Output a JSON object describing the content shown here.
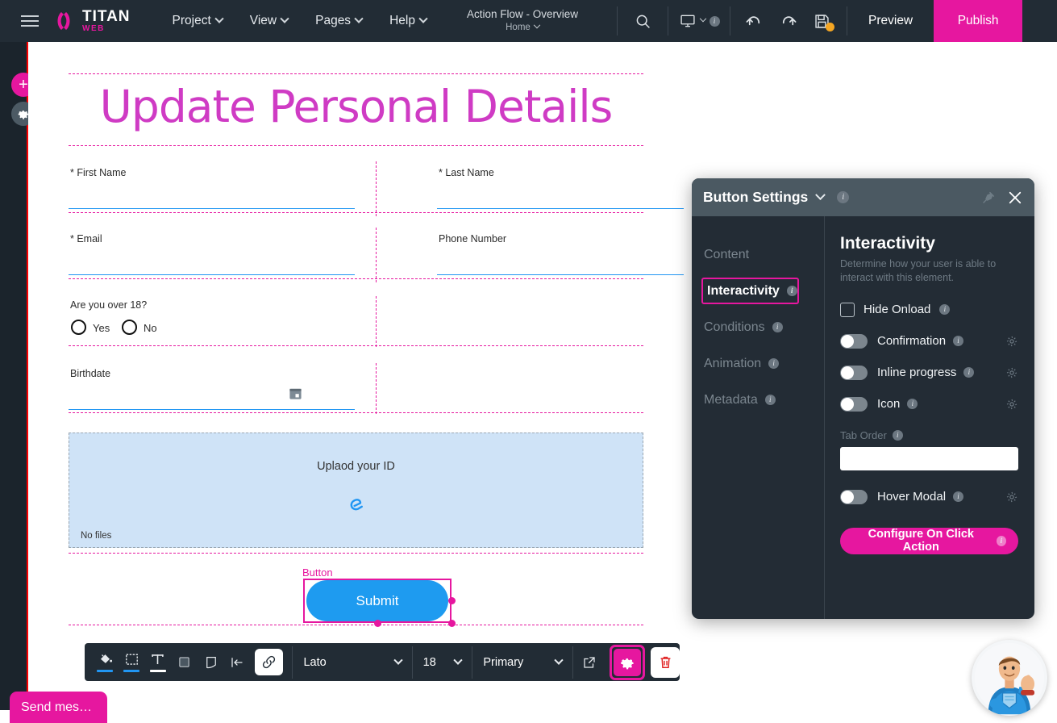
{
  "app": {
    "brand_name": "TITAN",
    "brand_sub": "WEB",
    "accent_pink": "#e6179f",
    "accent_blue": "#1e9bf0",
    "panel_bg": "#232c35",
    "topbar_bg": "#222c35"
  },
  "topbar": {
    "menu": [
      {
        "label": "Project"
      },
      {
        "label": "View"
      },
      {
        "label": "Pages"
      },
      {
        "label": "Help"
      }
    ],
    "flow_title": "Action Flow - Overview",
    "flow_page": "Home",
    "search_icon": "search-icon",
    "device_icon": "desktop-icon",
    "undo_icon": "undo-icon",
    "redo_icon": "redo-icon",
    "save_icon": "save-icon",
    "preview_label": "Preview",
    "publish_label": "Publish"
  },
  "leftrail": {
    "add_label": "+",
    "gear_label": "gear-icon"
  },
  "canvas": {
    "page_title": "Update Personal Details",
    "fields": [
      {
        "label": "* First Name"
      },
      {
        "label": "* Last Name"
      },
      {
        "label": "* Email"
      },
      {
        "label": "Phone Number"
      }
    ],
    "radio_question": "Are you over 18?",
    "radio_options": [
      "Yes",
      "No"
    ],
    "birthdate_label": "Birthdate",
    "upload": {
      "text": "Uplaod your ID",
      "icon": "paperclip-icon",
      "no_files": "No files"
    },
    "button_tag": "Button",
    "submit_label": "Submit"
  },
  "panel": {
    "title": "Button Settings",
    "pin_icon": "pin-icon",
    "close_icon": "close-icon",
    "nav": [
      {
        "label": "Content",
        "info": false,
        "active": false
      },
      {
        "label": "Interactivity",
        "info": true,
        "active": true
      },
      {
        "label": "Conditions",
        "info": true,
        "active": false
      },
      {
        "label": "Animation",
        "info": true,
        "active": false
      },
      {
        "label": "Metadata",
        "info": true,
        "active": false
      }
    ],
    "section_title": "Interactivity",
    "section_desc": "Determine how your user is able to interact with this element.",
    "hide_onload_label": "Hide Onload",
    "toggles": [
      {
        "label": "Confirmation",
        "on": false
      },
      {
        "label": "Inline progress",
        "on": false
      },
      {
        "label": "Icon",
        "on": false
      }
    ],
    "tab_order_label": "Tab Order",
    "tab_order_value": "",
    "hover_modal_label": "Hover Modal",
    "hover_modal_on": false,
    "configure_label": "Configure On Click Action"
  },
  "bottombar": {
    "tools": [
      {
        "name": "paint-bucket-icon",
        "underline": "#2196f3"
      },
      {
        "name": "border-box-icon",
        "underline": "#2196f3"
      },
      {
        "name": "text-format-icon",
        "underline": "#ffffff"
      },
      {
        "name": "fill-square-icon",
        "underline": ""
      },
      {
        "name": "shape-corner-icon",
        "underline": ""
      },
      {
        "name": "align-left-icon",
        "underline": ""
      },
      {
        "name": "link-icon",
        "underline": ""
      }
    ],
    "font_family": "Lato",
    "font_size": "18",
    "style_preset": "Primary",
    "open_external_icon": "open-external-icon",
    "settings_icon": "gear-icon",
    "delete_icon": "trash-icon"
  },
  "chat": {
    "bubble_label": "Send mes…",
    "mascot": "superhero-mascot-avatar"
  }
}
